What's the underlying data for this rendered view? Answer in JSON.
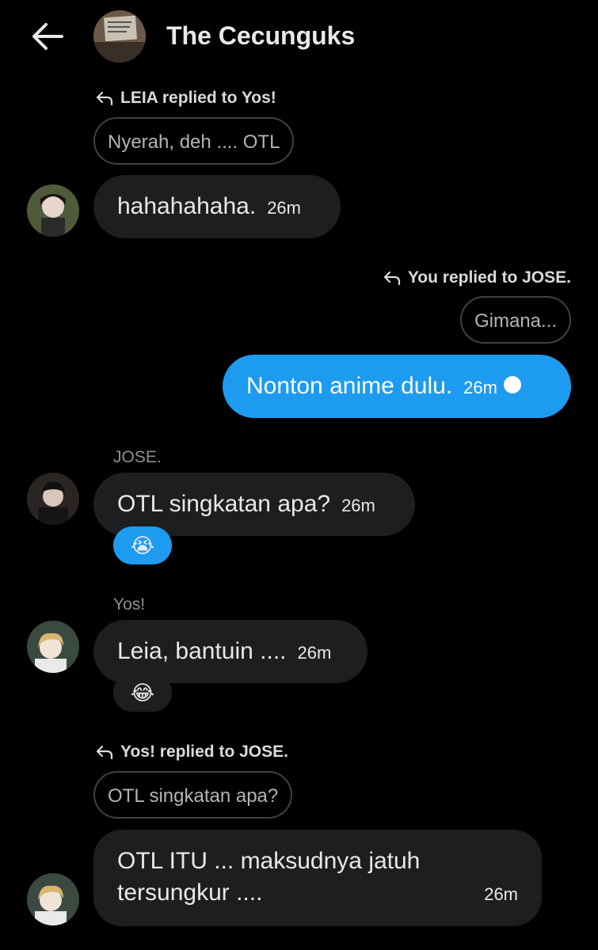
{
  "header": {
    "title": "The Cecunguks",
    "back_icon": "arrow-left-icon",
    "group_avatar": "group-avatar-photo"
  },
  "messages": [
    {
      "reply_context": "LEIA replied to Yos!",
      "quoted": "Nyerah, deh .... OTL",
      "text": "hahahahaha.",
      "time": "26m"
    },
    {
      "reply_context": "You replied to JOSE.",
      "quoted": "Gimana...",
      "text": "Nonton anime dulu.",
      "time": "26m",
      "status_icon": "sent-check-icon"
    },
    {
      "sender": "JOSE.",
      "text": "OTL singkatan apa?",
      "time": "26m",
      "reaction": "😭"
    },
    {
      "sender": "Yos!",
      "text": "Leia, bantuin ....",
      "time": "26m",
      "reaction": "😂"
    },
    {
      "reply_context": "Yos! replied to JOSE.",
      "quoted": "OTL singkatan apa?",
      "text_line1": "OTL ITU ... maksudnya jatuh",
      "text_line2": "tersungkur ....",
      "time": "26m"
    }
  ],
  "colors": {
    "background": "#000000",
    "bubble_other": "#1c1e20",
    "bubble_me": "#1d9bf0",
    "text": "#e7e9ea",
    "muted": "#8b9096"
  }
}
